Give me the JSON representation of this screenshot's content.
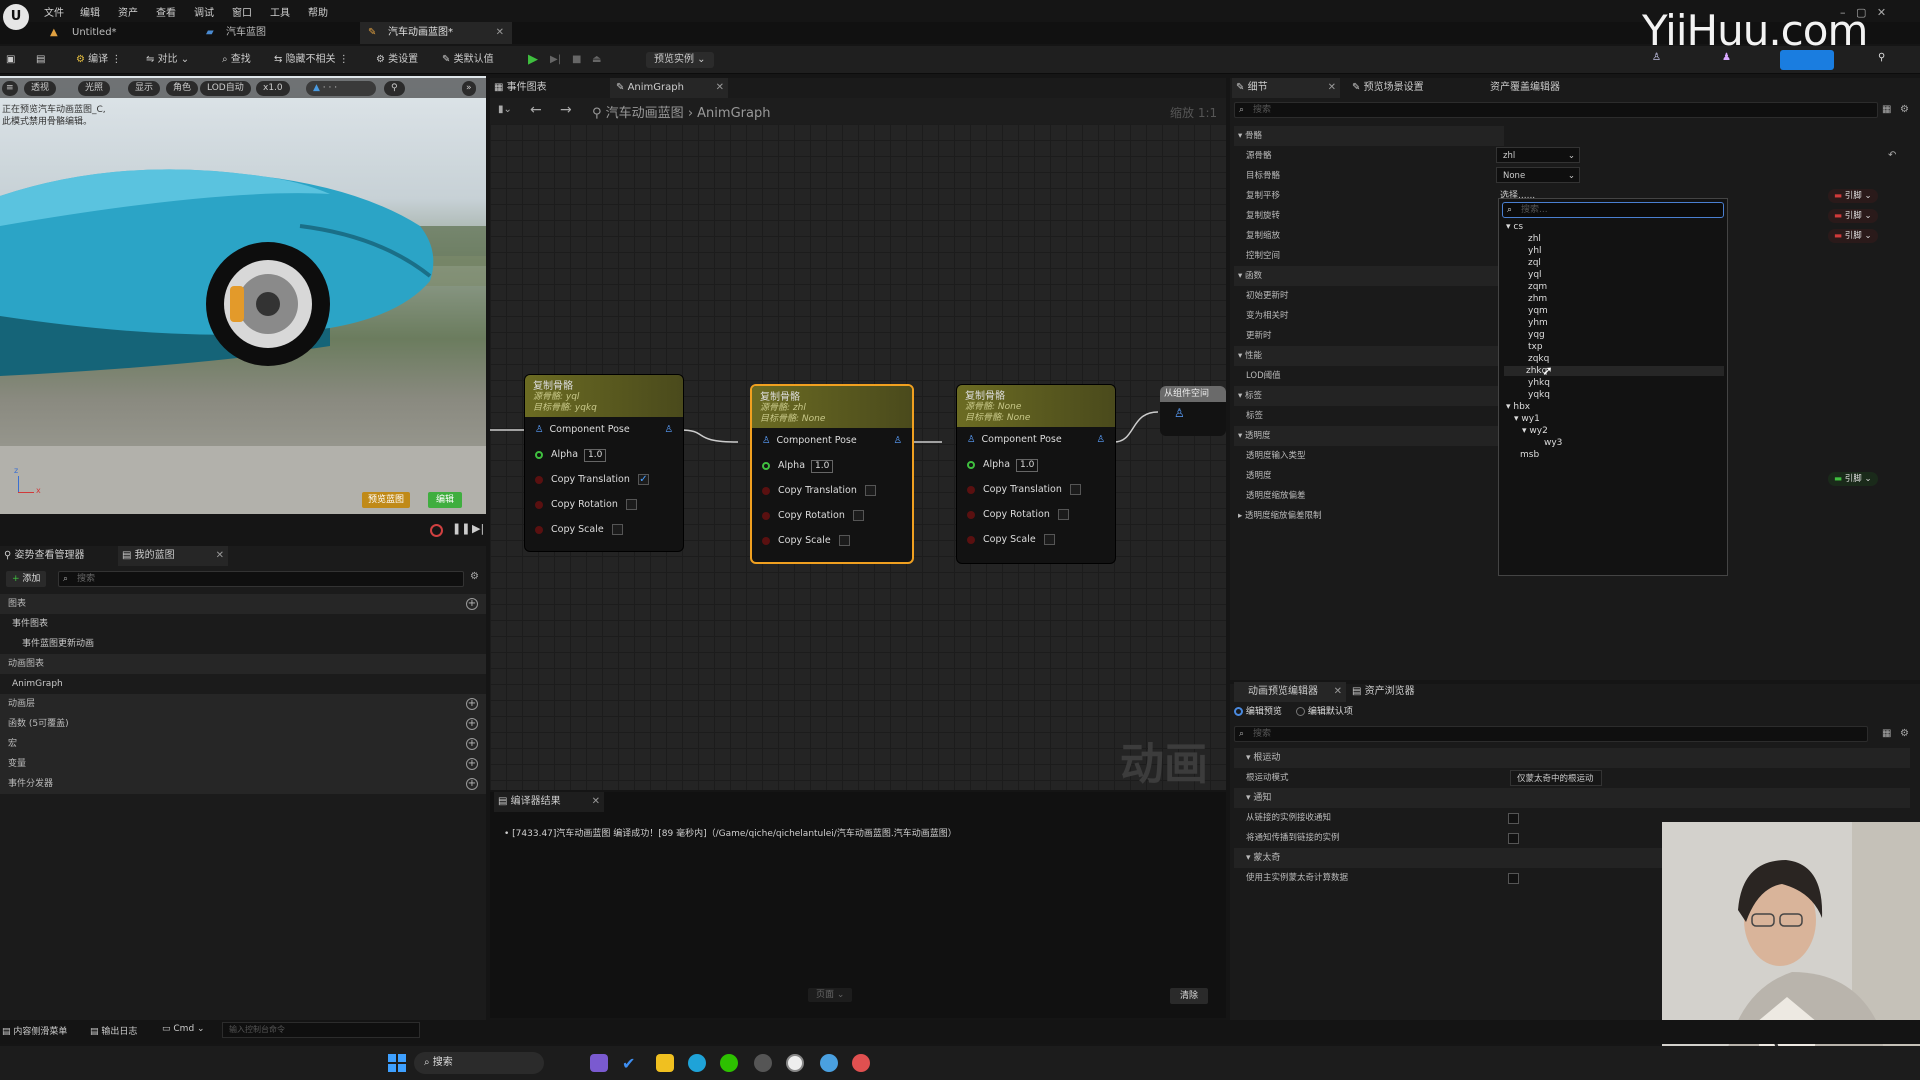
{
  "menu": [
    "文件",
    "编辑",
    "资产",
    "查看",
    "调试",
    "窗口",
    "工具",
    "帮助"
  ],
  "file_tabs": [
    {
      "label": "Untitled*"
    },
    {
      "label": "汽车蓝图"
    },
    {
      "label": "汽车动画蓝图*"
    }
  ],
  "watermark": "YiiHuu.com",
  "toolbar": {
    "compile": "编译",
    "diff": "对比",
    "find": "查找",
    "hide": "隐藏不相关",
    "class_settings": "类设置",
    "class_defaults": "类默认值",
    "preview_instance": "预览实例"
  },
  "viewport": {
    "pills": [
      "透视",
      "光照",
      "显示",
      "角色",
      "LOD自动",
      "x1.0"
    ],
    "warning_line1": "正在预览汽车动画蓝图_C,",
    "warning_line2": "此模式禁用骨骼编辑。",
    "btn_preview": "预览蓝图",
    "btn_edit": "编辑",
    "axis_z": "z",
    "axis_x": "x"
  },
  "left_panel": {
    "tab1": "姿势查看管理器",
    "tab2": "我的蓝图",
    "add": "添加",
    "search_placeholder": "搜索",
    "rows": [
      {
        "label": "图表",
        "section": true
      },
      {
        "label": "事件图表",
        "section": false
      },
      {
        "label": "事件蓝图更新动画",
        "section": false
      },
      {
        "label": "动画图表",
        "section": true
      },
      {
        "label": "AnimGraph",
        "section": false
      },
      {
        "label": "动画层",
        "section": true
      },
      {
        "label": "函数 (5可覆盖)",
        "section": true
      },
      {
        "label": "宏",
        "section": true
      },
      {
        "label": "变量",
        "section": true
      },
      {
        "label": "事件分发器",
        "section": true
      }
    ]
  },
  "graph": {
    "tab_event": "事件图表",
    "tab_anim": "AnimGraph",
    "breadcrumb_root": "汽车动画蓝图",
    "breadcrumb_leaf": "AnimGraph",
    "zoom": "缩放 1:1",
    "watermark": "动画",
    "nodes": [
      {
        "title": "复制骨骼",
        "src": "源骨骼: yql",
        "tgt": "目标骨骼: yqkq",
        "pose": "Component Pose",
        "alpha": "Alpha",
        "alpha_val": "1.0",
        "ct": "Copy Translation",
        "cr": "Copy Rotation",
        "cs": "Copy Scale",
        "ct_checked": true
      },
      {
        "title": "复制骨骼",
        "src": "源骨骼: zhl",
        "tgt": "目标骨骼: None",
        "pose": "Component Pose",
        "alpha": "Alpha",
        "alpha_val": "1.0",
        "ct": "Copy Translation",
        "cr": "Copy Rotation",
        "cs": "Copy Scale",
        "ct_checked": false
      },
      {
        "title": "复制骨骼",
        "src": "源骨骼: None",
        "tgt": "目标骨骼: None",
        "pose": "Component Pose",
        "alpha": "Alpha",
        "alpha_val": "1.0",
        "ct": "Copy Translation",
        "cr": "Copy Rotation",
        "cs": "Copy Scale",
        "ct_checked": false
      }
    ],
    "output_node": "从组件空间"
  },
  "compile_panel": {
    "tab": "编译器结果",
    "message": "[7433.47]汽车动画蓝图 编译成功！[89 毫秒内]（/Game/qiche/qichelantulei/汽车动画蓝图.汽车动画蓝图）",
    "page_btn": "页面",
    "clear": "清除"
  },
  "details": {
    "tab1": "细节",
    "tab2": "预览场景设置",
    "tab3": "资产覆盖编辑器",
    "search_placeholder": "搜索",
    "rows": [
      {
        "label": "骨骼",
        "section": true
      },
      {
        "label": "源骨骼",
        "section": false,
        "value": "zhl"
      },
      {
        "label": "目标骨骼",
        "section": false,
        "value": "None"
      },
      {
        "label": "复制平移",
        "section": false
      },
      {
        "label": "复制旋转",
        "section": false
      },
      {
        "label": "复制缩放",
        "section": false
      },
      {
        "label": "控制空间",
        "section": false
      },
      {
        "label": "函数",
        "section": true
      },
      {
        "label": "初始更新时",
        "section": false
      },
      {
        "label": "变为相关时",
        "section": false
      },
      {
        "label": "更新时",
        "section": false
      },
      {
        "label": "性能",
        "section": true
      },
      {
        "label": "LOD阈值",
        "section": false
      },
      {
        "label": "标签",
        "section": true
      },
      {
        "label": "标签",
        "section": false
      },
      {
        "label": "透明度",
        "section": true
      },
      {
        "label": "透明度输入类型",
        "section": false
      },
      {
        "label": "透明度",
        "section": false
      },
      {
        "label": "透明度缩放偏差",
        "section": false
      },
      {
        "label": "透明度缩放偏差限制",
        "section": false
      }
    ],
    "pin_label": "引脚",
    "popup_header": "选择......",
    "popup_search": "搜索...",
    "bones": [
      "cs",
      "zhl",
      "yhl",
      "zql",
      "yql",
      "zqm",
      "zhm",
      "yqm",
      "yhm",
      "yqg",
      "txp",
      "zqkq",
      "zhkq",
      "yhkq",
      "yqkq",
      "hbx",
      "wy1",
      "wy2",
      "wy3",
      "msb"
    ]
  },
  "preview_editor": {
    "tab1": "动画预览编辑器",
    "tab2": "资产浏览器",
    "radio1": "编辑预览",
    "radio2": "编辑默认项",
    "search_placeholder": "搜索",
    "sec_root": "根运动",
    "root_mode": "根运动模式",
    "root_mode_val": "仅蒙太奇中的根运动",
    "sec_notify": "通知",
    "notify1": "从链接的实例接收通知",
    "notify2": "将通知传播到链接的实例",
    "sec_montage": "蒙太奇",
    "montage1": "使用主实例蒙太奇计算数据"
  },
  "statusbar": {
    "content": "内容侧滑菜单",
    "log": "输出日志",
    "cmd": "Cmd",
    "cmd_placeholder": "输入控制台命令"
  },
  "taskbar": {
    "search": "搜索"
  }
}
